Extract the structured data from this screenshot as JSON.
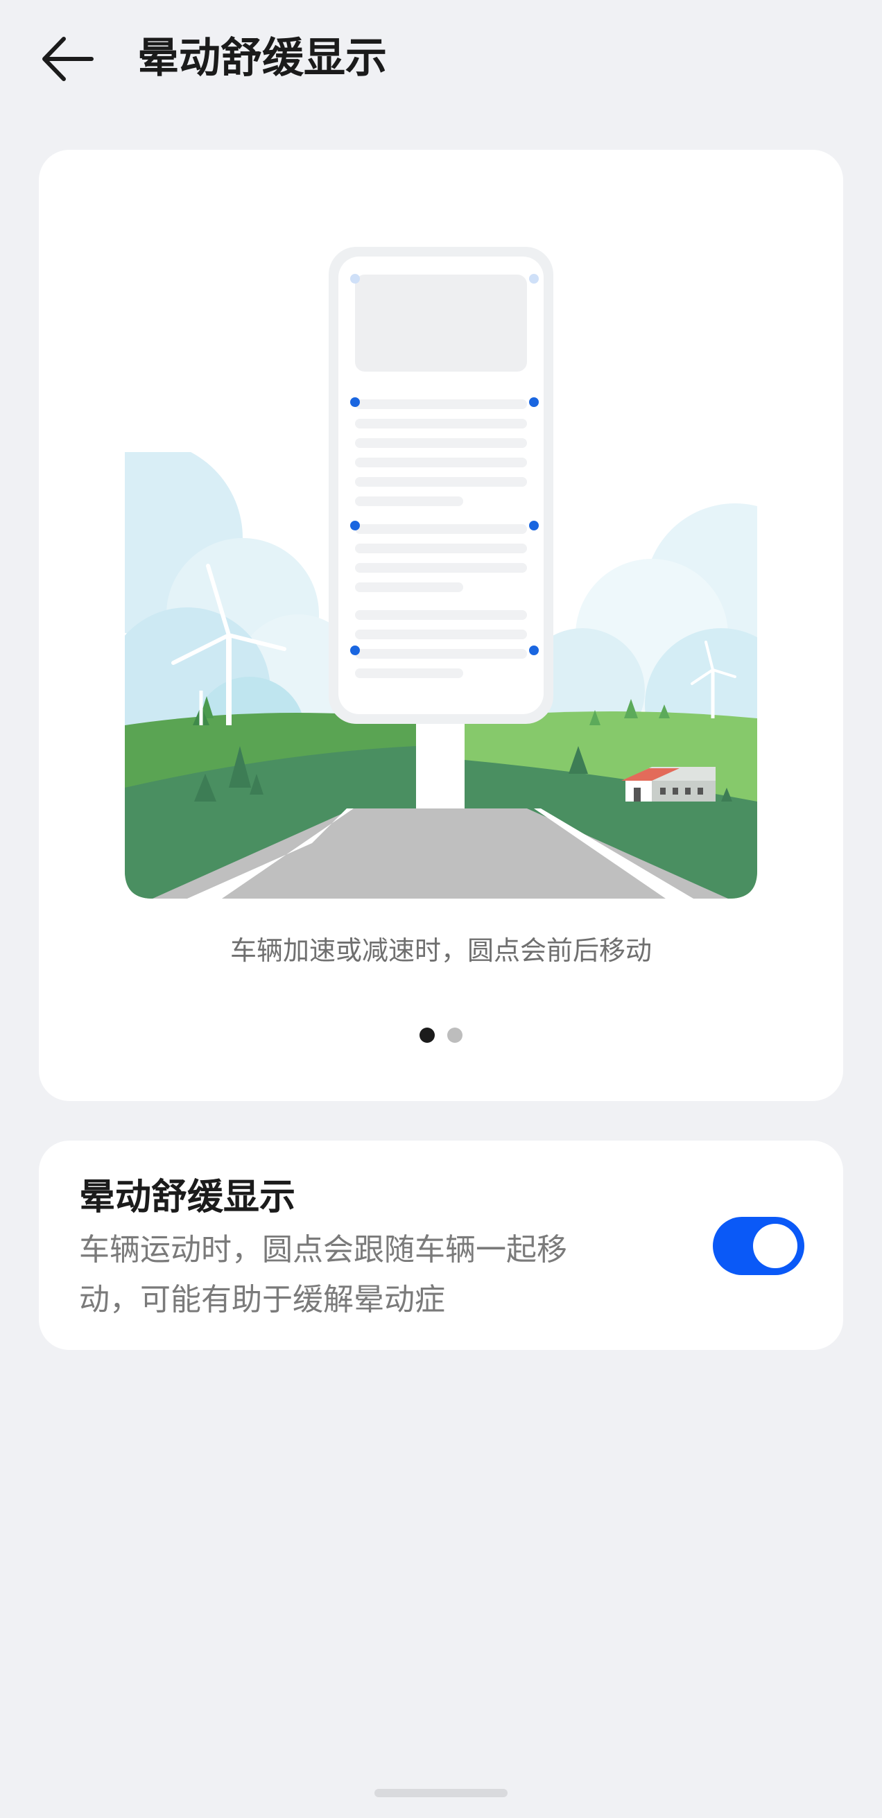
{
  "header": {
    "title": "晕动舒缓显示",
    "back_icon": "back-arrow-icon"
  },
  "illustration": {
    "caption": "车辆加速或减速时，圆点会前后移动",
    "pages": 2,
    "active_page": 1,
    "dot_color": "#1a66e0"
  },
  "setting": {
    "title": "晕动舒缓显示",
    "desc_line1": "车辆运动时，圆点会跟随车辆一起移",
    "desc_line2": "动，可能有助于缓解晕动症",
    "enabled": true,
    "accent": "#0a59f7"
  }
}
